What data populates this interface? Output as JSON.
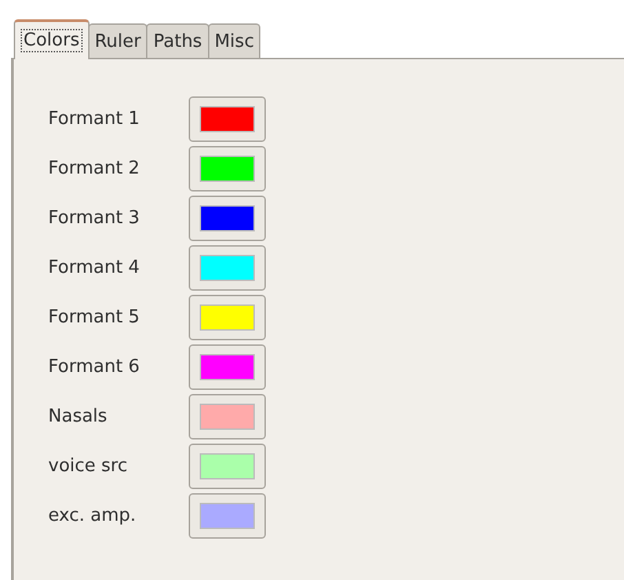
{
  "tabs": [
    {
      "label": "Colors",
      "selected": true
    },
    {
      "label": "Ruler",
      "selected": false
    },
    {
      "label": "Paths",
      "selected": false
    },
    {
      "label": "Misc",
      "selected": false
    }
  ],
  "colors": [
    {
      "label": "Formant 1",
      "color": "#ff0000"
    },
    {
      "label": "Formant 2",
      "color": "#00ff00"
    },
    {
      "label": "Formant 3",
      "color": "#0000ff"
    },
    {
      "label": "Formant 4",
      "color": "#00ffff"
    },
    {
      "label": "Formant 5",
      "color": "#ffff00"
    },
    {
      "label": "Formant 6",
      "color": "#ff00ff"
    },
    {
      "label": "Nasals",
      "color": "#ffaaaa"
    },
    {
      "label": "voice src",
      "color": "#aaffaa"
    },
    {
      "label": "exc. amp.",
      "color": "#aaaaff"
    }
  ]
}
